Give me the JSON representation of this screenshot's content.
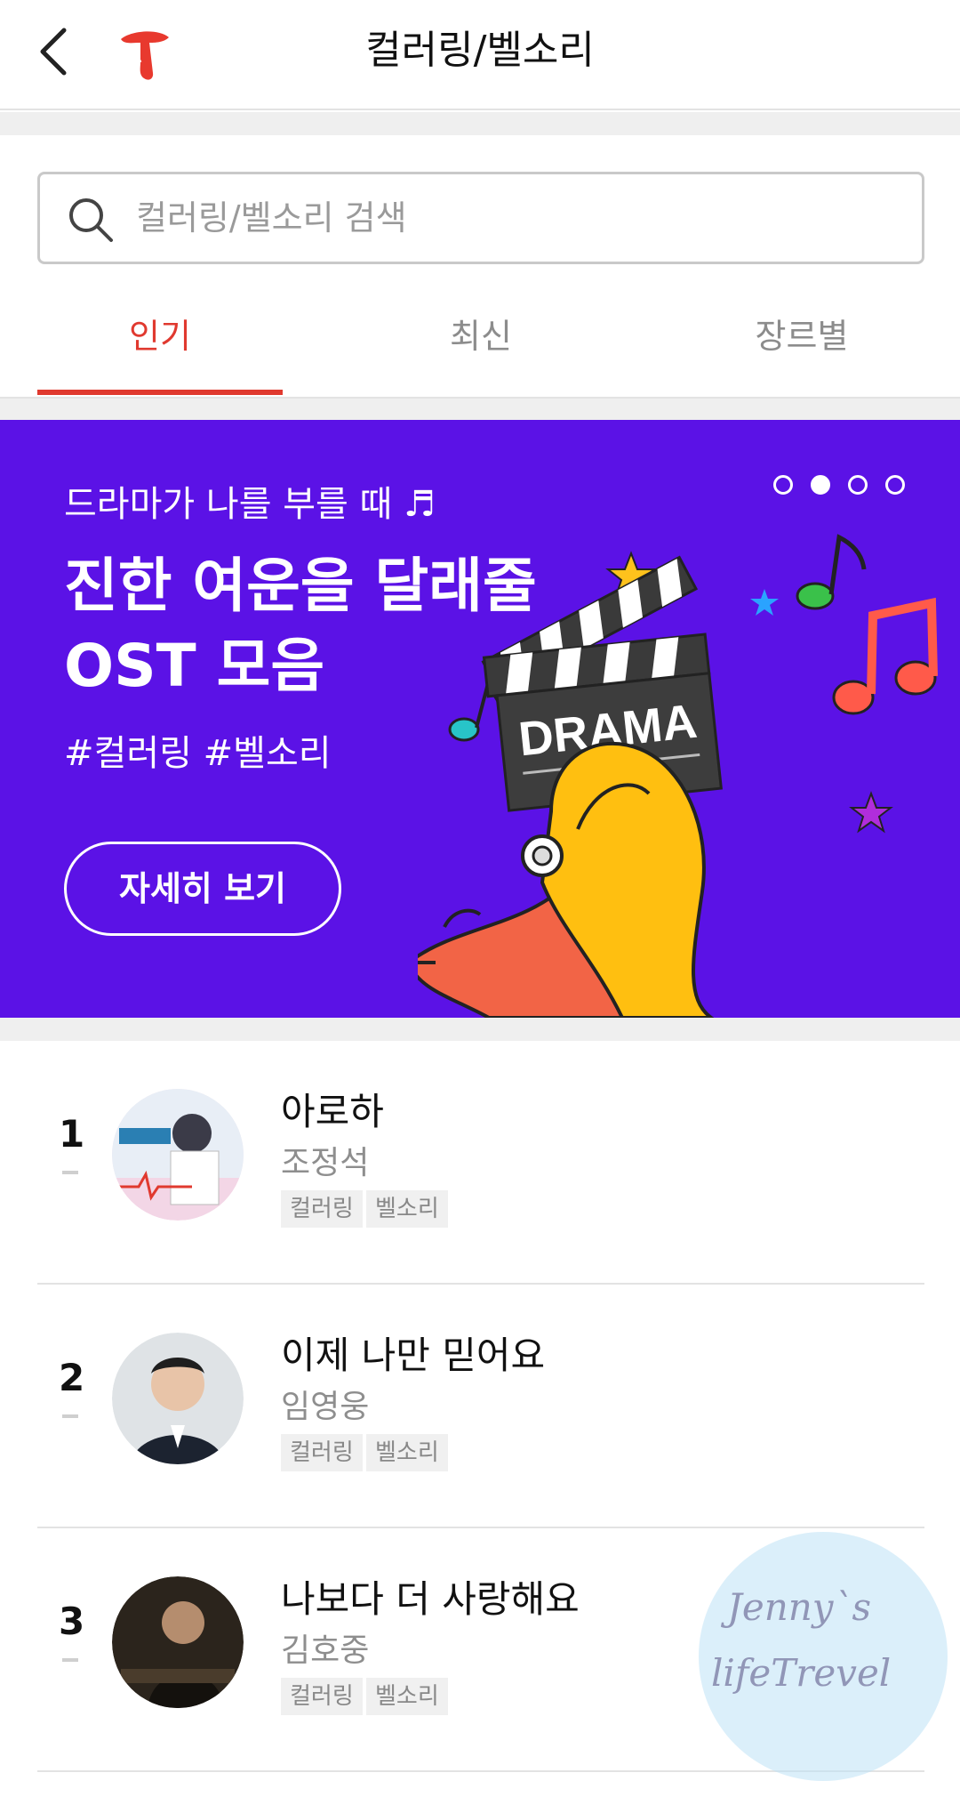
{
  "header": {
    "title": "컬러링/벨소리"
  },
  "search": {
    "placeholder": "컬러링/벨소리 검색"
  },
  "tabs": [
    {
      "label": "인기",
      "active": true
    },
    {
      "label": "최신",
      "active": false
    },
    {
      "label": "장르별",
      "active": false
    }
  ],
  "banner": {
    "subtitle": "드라마가 나를 부를 때 ♬",
    "title_line1": "진한 여운을 달래줄",
    "title_line2": "OST 모음",
    "tags": "#컬러링 #벨소리",
    "button": "자세히 보기",
    "clapper_text": "DRAMA",
    "pagination": {
      "total": 4,
      "current": 2
    },
    "background_color": "#5b12e6"
  },
  "list": [
    {
      "rank": "1",
      "title": "아로하",
      "artist": "조정석",
      "chips": [
        "컬러링",
        "벨소리"
      ]
    },
    {
      "rank": "2",
      "title": "이제 나만 믿어요",
      "artist": "임영웅",
      "chips": [
        "컬러링",
        "벨소리"
      ]
    },
    {
      "rank": "3",
      "title": "나보다 더 사랑해요",
      "artist": "김호중",
      "chips": [
        "컬러링",
        "벨소리"
      ]
    }
  ],
  "watermark": {
    "line1": "Jenny`s",
    "line2": "lifeTrevel"
  },
  "colors": {
    "accent": "#e0392f"
  }
}
